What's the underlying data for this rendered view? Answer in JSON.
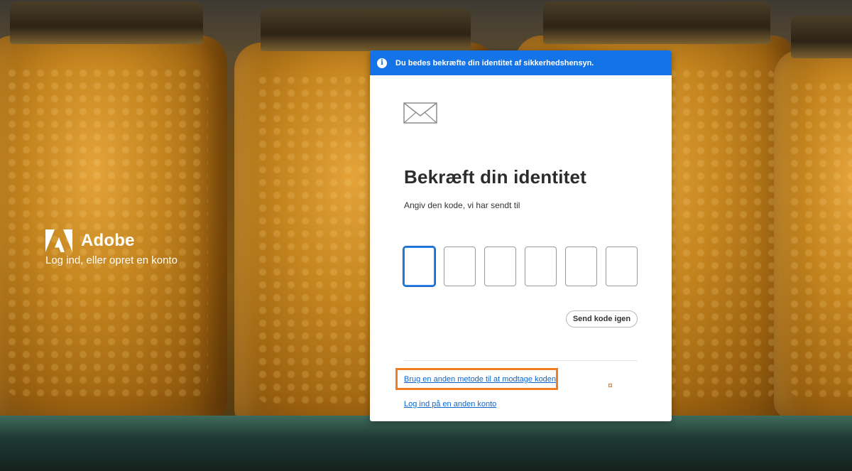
{
  "brand": {
    "name": "Adobe",
    "subtitle": "Log ind, eller opret en konto",
    "logo_icon": "adobe-logo-icon"
  },
  "banner": {
    "icon": "info-icon",
    "text": "Du bedes bekræfte din identitet af sikkerhedshensyn.",
    "color": "#1473e6"
  },
  "card": {
    "mail_icon": "envelope-icon",
    "title": "Bekræft din identitet",
    "subtitle": "Angiv den kode, vi har sendt til",
    "code_fields": [
      {
        "value": "",
        "active": true
      },
      {
        "value": "",
        "active": false
      },
      {
        "value": "",
        "active": false
      },
      {
        "value": "",
        "active": false
      },
      {
        "value": "",
        "active": false
      },
      {
        "value": "",
        "active": false
      }
    ],
    "resend_label": "Send kode igen",
    "alt_method_link": "Brug en anden metode til at modtage koden",
    "other_account_link": "Log ind på en anden konto"
  },
  "colors": {
    "accent": "#1473e6",
    "link": "#0d66d0",
    "highlight": "#ef7d22"
  }
}
